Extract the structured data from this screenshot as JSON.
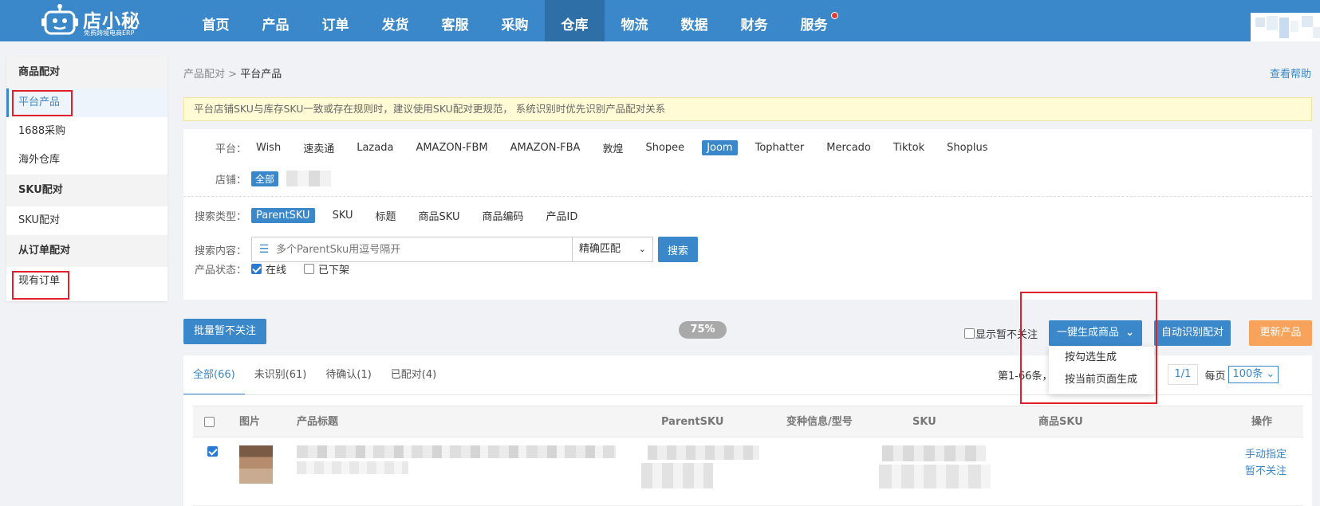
{
  "logo": {
    "name": "店小秘",
    "subtitle": "免费跨境电商ERP"
  },
  "nav": [
    {
      "label": "首页"
    },
    {
      "label": "产品"
    },
    {
      "label": "订单"
    },
    {
      "label": "发货"
    },
    {
      "label": "客服"
    },
    {
      "label": "采购"
    },
    {
      "label": "仓库",
      "active": true
    },
    {
      "label": "物流"
    },
    {
      "label": "数据"
    },
    {
      "label": "财务"
    },
    {
      "label": "服务",
      "dot": true
    }
  ],
  "sidebar": {
    "sections": [
      {
        "title": "商品配对",
        "items": [
          "平台产品",
          "1688采购",
          "海外仓库"
        ]
      },
      {
        "title": "SKU配对",
        "items": [
          "SKU配对"
        ]
      },
      {
        "title": "从订单配对",
        "items": [
          "现有订单"
        ]
      }
    ]
  },
  "breadcrumb": {
    "parent": "产品配对",
    "sep": " > ",
    "current": "平台产品"
  },
  "help": "查看帮助",
  "notice": "平台店铺SKU与库存SKU一致或存在规则时，建议使用SKU配对更规范， 系统识别时优先识别产品配对关系",
  "filters": {
    "platform_label": "平台：",
    "platforms": [
      "Wish",
      "速卖通",
      "Lazada",
      "AMAZON-FBM",
      "AMAZON-FBA",
      "敦煌",
      "Shopee",
      "Joom",
      "Tophatter",
      "Mercado",
      "Tiktok",
      "Shoplus"
    ],
    "selected_platform": "Joom",
    "store_label": "店铺：",
    "store_all": "全部",
    "search_type_label": "搜索类型：",
    "search_types": [
      "ParentSKU",
      "SKU",
      "标题",
      "商品SKU",
      "商品编码",
      "产品ID"
    ],
    "selected_search_type": "ParentSKU",
    "search_content_label": "搜索内容：",
    "search_placeholder": "多个ParentSku用逗号隔开",
    "match_mode": "精确匹配",
    "search_button": "搜索",
    "status_label": "产品状态：",
    "status_online": "在线",
    "status_offline": "已下架"
  },
  "actions": {
    "batch_ignore": "批量暂不关注",
    "progress": "75%",
    "show_ignored": "显示暂不关注",
    "one_click_generate": "一键生成商品",
    "generate_options": [
      "按勾选生成",
      "按当前页面生成"
    ],
    "auto_match": "自动识别配对",
    "update_products": "更新产品"
  },
  "tabs": [
    {
      "label": "全部(66)",
      "active": true
    },
    {
      "label": "未识别(61)"
    },
    {
      "label": "待确认(1)"
    },
    {
      "label": "已配对(4)"
    }
  ],
  "pager": {
    "summary": "第1-66条，",
    "page": "1/1",
    "per_page_label": "每页",
    "per_page": "100条"
  },
  "table": {
    "headers": [
      "图片",
      "产品标题",
      "ParentSKU",
      "变种信息/型号",
      "SKU",
      "商品SKU",
      "操作"
    ],
    "row_actions": [
      "手动指定",
      "暂不关注"
    ]
  },
  "colors": {
    "brand": "#3a87c9",
    "highlight": "#e0202a",
    "warning": "#f7a35c"
  }
}
